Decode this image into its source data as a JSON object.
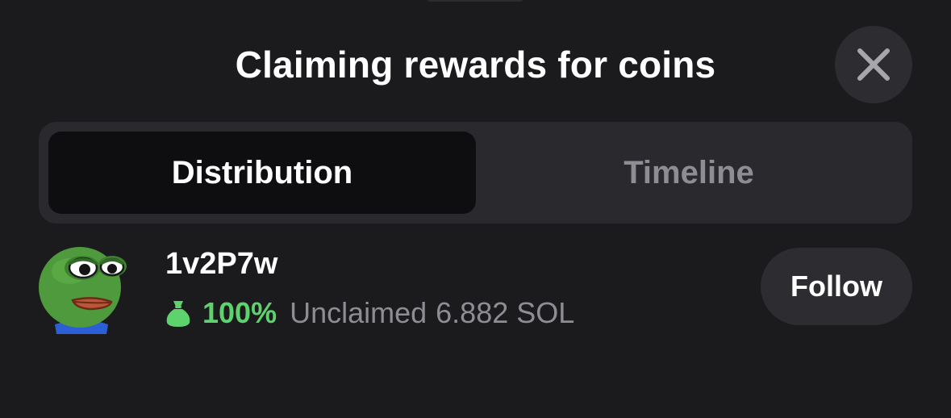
{
  "header": {
    "title": "Claiming rewards for coins",
    "close_icon": "close-icon"
  },
  "tabs": [
    {
      "label": "Distribution",
      "active": true
    },
    {
      "label": "Timeline",
      "active": false
    }
  ],
  "holders": [
    {
      "avatar": "pepe-frog-avatar",
      "name": "1v2P7w",
      "percent": "100%",
      "unclaimed_label": "Unclaimed",
      "unclaimed_value": "6.882 SOL",
      "icon": "money-bag-icon",
      "action_label": "Follow"
    }
  ],
  "colors": {
    "background": "#1b1b1e",
    "segment_bg": "#2a2a2e",
    "active_tab_bg": "#0e0e11",
    "button_bg": "#2d2d31",
    "accent_green": "#5ed26d",
    "muted_text": "#8d8d93"
  }
}
